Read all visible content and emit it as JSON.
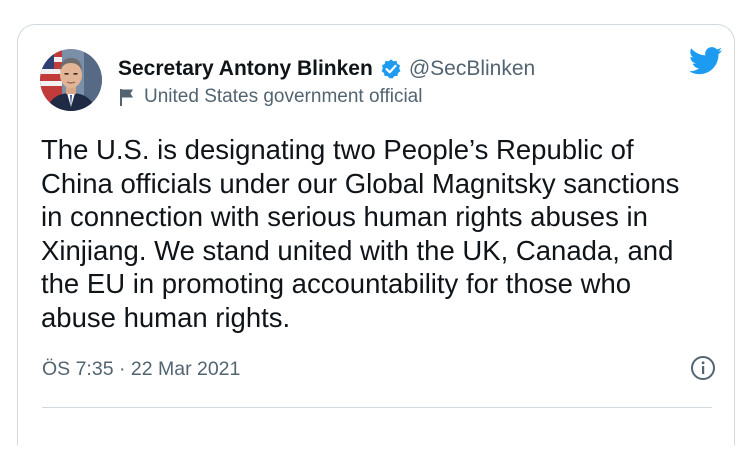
{
  "tweet": {
    "author": {
      "display_name": "Secretary Antony Blinken",
      "handle": "@SecBlinken",
      "label": "United States government official"
    },
    "text_lines": [
      "The U.S. is designating two People’s Republic of",
      "China officials under our Global Magnitsky sanctions",
      "in connection with serious human rights abuses in",
      "Xinjiang. We stand united with the UK, Canada, and",
      "the EU in promoting accountability for those who",
      "abuse human rights."
    ],
    "timestamp": "ÖS 7:35 · 22 Mar 2021"
  },
  "icons": {
    "brand": "twitter-bird-icon",
    "verified": "verified-badge-icon",
    "label": "flag-icon",
    "info": "info-icon"
  },
  "colors": {
    "brand": "#1d9bf0",
    "text": "#0f1419",
    "secondary": "#536471",
    "border": "#cfd9de"
  }
}
